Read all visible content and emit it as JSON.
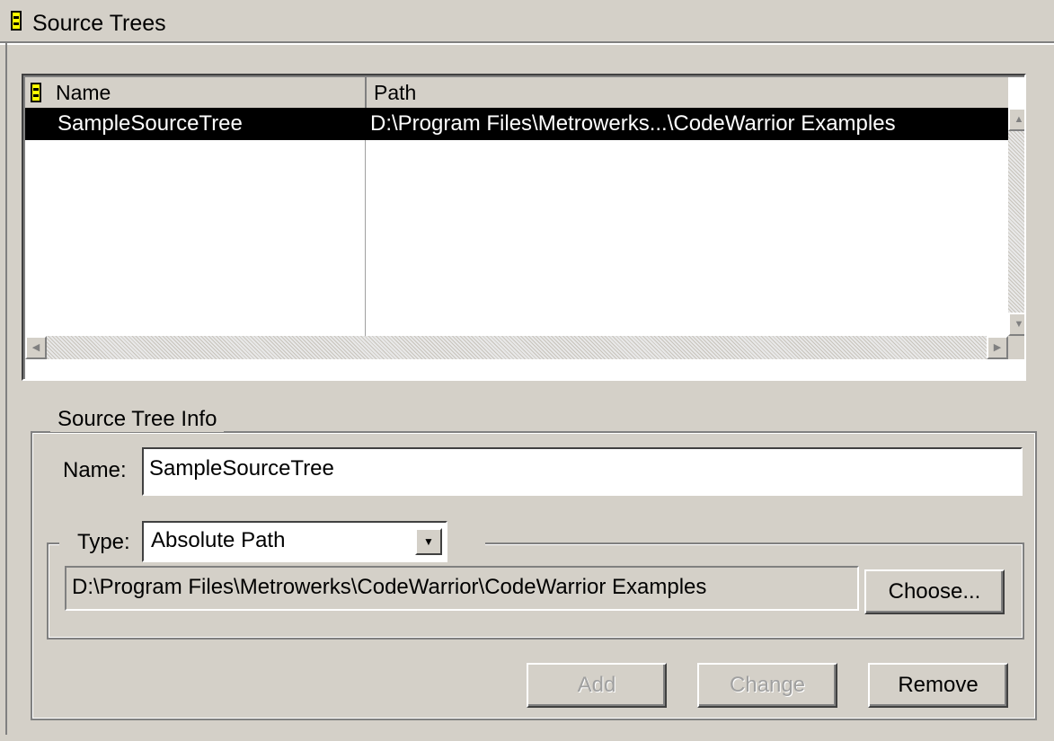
{
  "title": "Source Trees",
  "list": {
    "columns": [
      "Name",
      "Path"
    ],
    "rows": [
      {
        "name": "SampleSourceTree",
        "path": "D:\\Program Files\\Metrowerks...\\CodeWarrior Examples",
        "selected": true
      }
    ]
  },
  "info": {
    "group_label": "Source Tree Info",
    "name_label": "Name:",
    "name_value": "SampleSourceTree",
    "type_label": "Type:",
    "type_value": "Absolute Path",
    "path_value": "D:\\Program Files\\Metrowerks\\CodeWarrior\\CodeWarrior Examples",
    "choose_label": "Choose..."
  },
  "buttons": {
    "add": "Add",
    "change": "Change",
    "remove": "Remove"
  },
  "icons": {
    "title": "source-tree-icon",
    "header": "source-tree-icon"
  }
}
